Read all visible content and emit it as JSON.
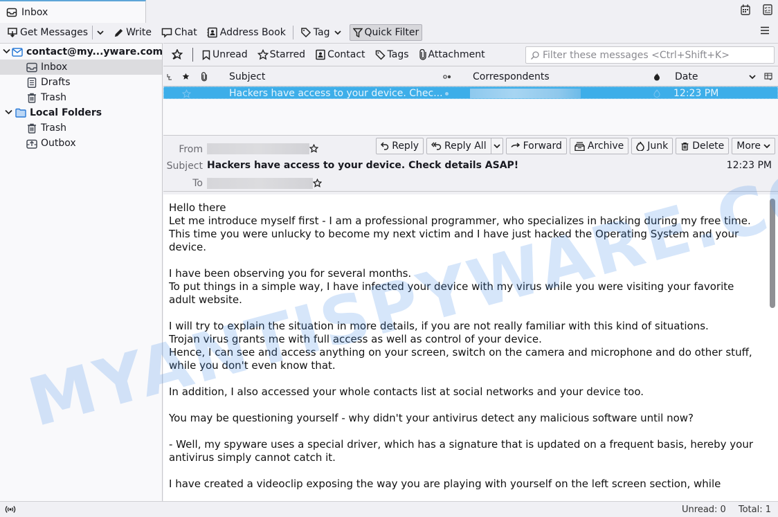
{
  "tab": {
    "label": "Inbox",
    "icon": "inbox-icon"
  },
  "tabbar_right": [
    {
      "name": "calendar-icon"
    },
    {
      "name": "tasks-icon"
    }
  ],
  "toolbar": {
    "get_messages": "Get Messages",
    "write": "Write",
    "chat": "Chat",
    "address_book": "Address Book",
    "tag": "Tag",
    "quick_filter": "Quick Filter"
  },
  "folders": {
    "account": "contact@my...yware.com",
    "account_items": [
      "Inbox",
      "Drafts",
      "Trash"
    ],
    "local": "Local Folders",
    "local_items": [
      "Trash",
      "Outbox"
    ]
  },
  "quick_filter_bar": {
    "unread": "Unread",
    "starred": "Starred",
    "contact": "Contact",
    "tags": "Tags",
    "attachment": "Attachment",
    "filter_placeholder": "Filter these messages <Ctrl+Shift+K>"
  },
  "thread_columns": {
    "subject": "Subject",
    "correspondents": "Correspondents",
    "date": "Date"
  },
  "messages": [
    {
      "subject": "Hackers have access to your device. Chec...",
      "date": "12:23 PM",
      "selected": true
    }
  ],
  "message_header": {
    "from_label": "From",
    "subject_label": "Subject",
    "to_label": "To",
    "subject": "Hackers have access to your device. Check details ASAP!",
    "date": "12:23 PM",
    "actions": {
      "reply": "Reply",
      "reply_all": "Reply All",
      "forward": "Forward",
      "archive": "Archive",
      "junk": "Junk",
      "delete": "Delete",
      "more": "More"
    }
  },
  "body": "Hello there\nLet me introduce myself first - I am a professional programmer, who specializes in hacking during my free time.\nThis time you were unlucky to become my next victim and I have just hacked the Operating System and your device.\n\nI have been observing you for several months.\nTo put things in a simple way, I have infected your device with my virus while you were visiting your favorite adult website.\n\nI will try to explain the situation in more details, if you are not really familiar with this kind of situations.\nTrojan virus grants me with full access as well as control of your device.\nHence, I can see and access anything on your screen, switch on the camera and microphone and do other stuff, while you don't even know that.\n\nIn addition, I also accessed your whole contacts list at social networks and your device too.\n\nYou may be questioning yourself - why didn't your antivirus detect any malicious software until now?\n\n- Well, my spyware uses a special driver, which has a signature that is updated on a frequent basis, hereby your antivirus simply cannot catch it.\n\nI have created a videoclip exposing the way you are playing with yourself on the left screen section, while",
  "watermark": "MYANTISPYWARE.COM",
  "status": {
    "unread": "Unread: 0",
    "total": "Total: 1"
  }
}
